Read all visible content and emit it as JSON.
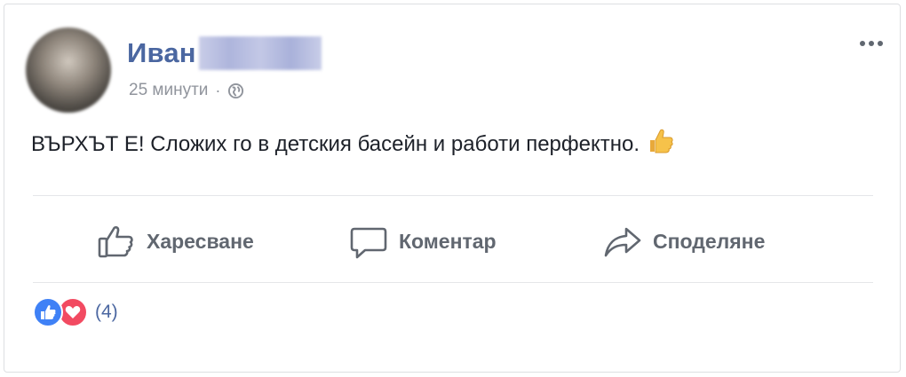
{
  "post": {
    "author_first_name": "Иван",
    "timestamp": "25 минути",
    "separator": "·",
    "privacy_icon": "globe-icon",
    "text": "ВЪРХЪТ Е! Сложих го в детския басейн и работи перфектно.",
    "emoji": "thumbs-up-emoji"
  },
  "actions": {
    "like_label": "Харесване",
    "comment_label": "Коментар",
    "share_label": "Споделяне"
  },
  "reactions": {
    "types": [
      "like-icon",
      "love-icon"
    ],
    "count": "(4)"
  },
  "colors": {
    "name": "#4b67a1",
    "meta": "#90949c",
    "action": "#616770",
    "like": "#3f81f6",
    "love": "#f24a61"
  }
}
